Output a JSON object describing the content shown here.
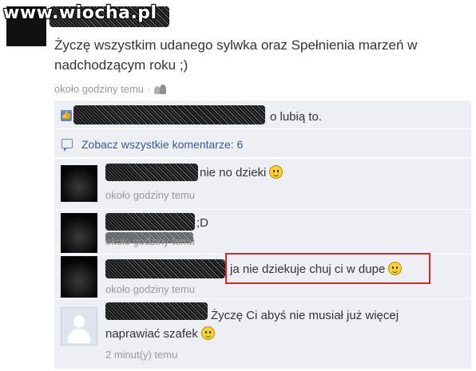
{
  "watermark": "www.wiocha.pl",
  "post": {
    "text_line1": "Życzę wszystkim udanego sylwka oraz Spełnienia marzeń w",
    "text_line2": "nadchodzącym roku ;)",
    "time": "około godziny temu",
    "separator": "·",
    "audience_icon": "people-icon"
  },
  "likes": {
    "icon": "like-thumb-icon",
    "text": "o lubią to."
  },
  "view_all": {
    "icon": "comment-bubble-icon",
    "label": "Zobacz wszystkie komentarze: 6"
  },
  "comments": [
    {
      "text": "nie no dzieki",
      "emoticon": "smiley-icon",
      "time": "około godziny temu",
      "avatar": "dark"
    },
    {
      "text": ";D",
      "emoticon": "",
      "time": "około godziny temu",
      "avatar": "dark"
    },
    {
      "text": "ja nie dziekuje chuj ci w dupe",
      "emoticon": "smiley-icon",
      "time": "około godziny temu",
      "avatar": "dark"
    },
    {
      "text_line1": "Życzę Ci abyś nie musiał już więcej",
      "text_line2": "naprawiać szafek",
      "emoticon": "smiley-icon",
      "time": "2 minut(y) temu",
      "avatar": "blank"
    }
  ],
  "colors": {
    "link": "#3b5998",
    "feedback_bg": "#edeff4",
    "timestamp": "#999999",
    "highlight_border": "#dd2222"
  }
}
